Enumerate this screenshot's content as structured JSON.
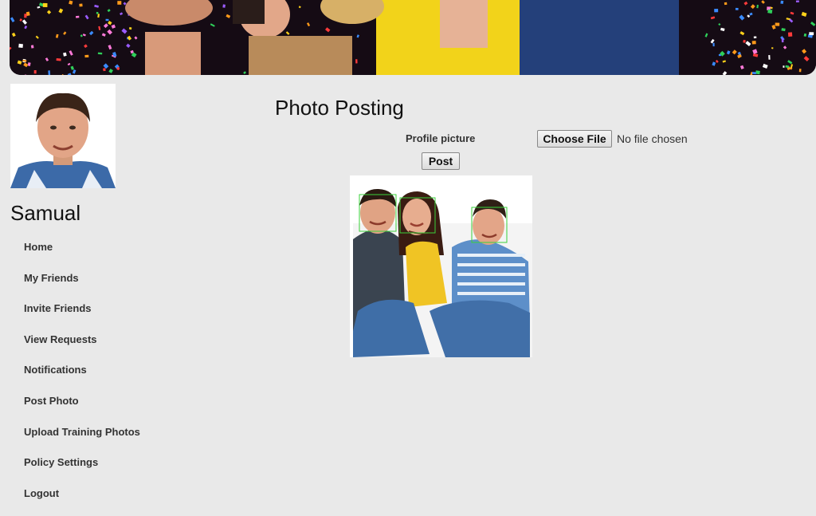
{
  "profile": {
    "name": "Samual"
  },
  "nav": {
    "items": [
      {
        "label": "Home"
      },
      {
        "label": "My Friends"
      },
      {
        "label": "Invite Friends"
      },
      {
        "label": "View Requests"
      },
      {
        "label": "Notifications"
      },
      {
        "label": "Post Photo"
      },
      {
        "label": "Upload Training Photos"
      },
      {
        "label": "Policy Settings"
      },
      {
        "label": "Logout"
      }
    ]
  },
  "main": {
    "title": "Photo Posting",
    "field_label": "Profile picture",
    "file_button_label": "Choose File",
    "file_status": "No file chosen",
    "post_button_label": "Post"
  },
  "colors": {
    "background": "#e9e9e9",
    "face_box": "#3ad13a"
  }
}
